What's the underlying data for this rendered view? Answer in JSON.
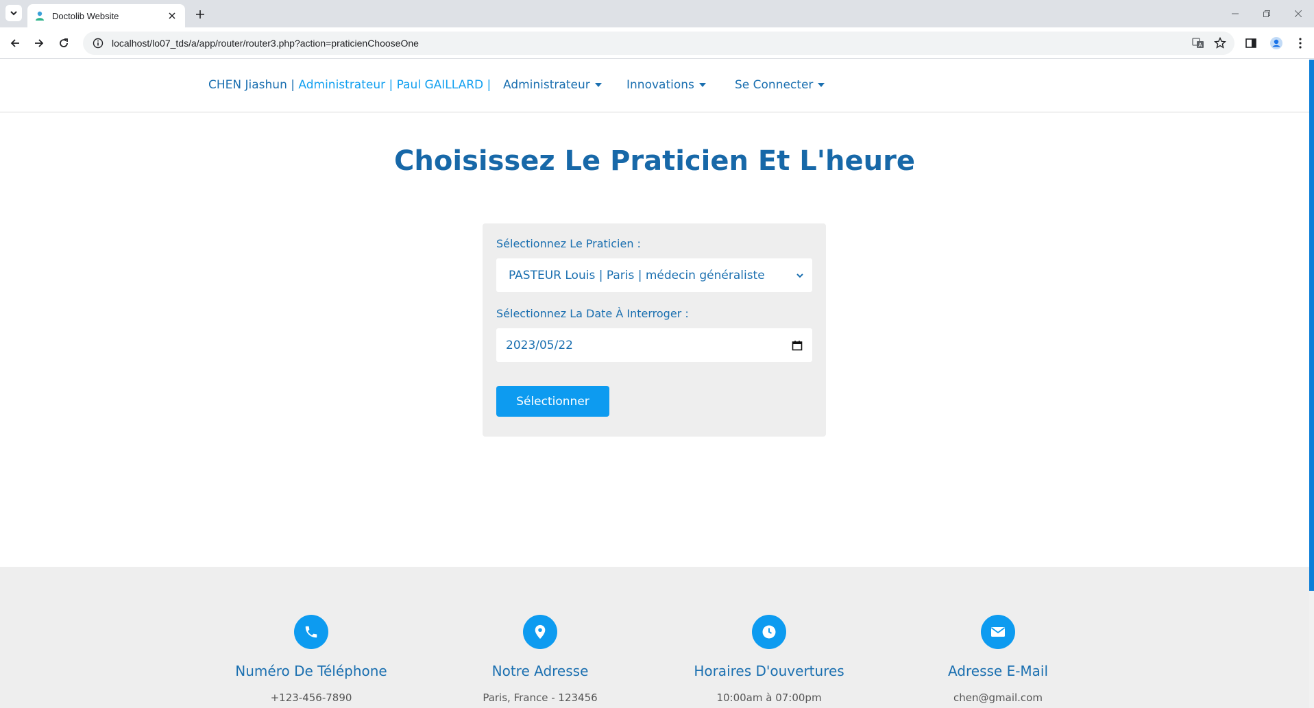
{
  "browser": {
    "tab_title": "Doctolib Website",
    "url": "localhost/lo07_tds/a/app/router/router3.php?action=praticienChooseOne"
  },
  "navbar": {
    "user_name": "CHEN Jiashun | ",
    "user_roles": "Administrateur | Paul GAILLARD |",
    "menu_admin": "Administrateur",
    "menu_innovations": "Innovations",
    "menu_connect": "Se Connecter"
  },
  "main": {
    "title": "Choisissez Le Praticien Et L'heure",
    "form": {
      "praticien_label": "Sélectionnez Le Praticien :",
      "praticien_value": "PASTEUR Louis | Paris | médecin généraliste",
      "date_label": "Sélectionnez La Date À Interroger :",
      "date_value": "2023/05/22",
      "submit_label": "Sélectionner"
    }
  },
  "footer": {
    "phone": {
      "title": "Numéro De Téléphone",
      "text": "+123-456-7890",
      "icon": "phone-icon"
    },
    "address": {
      "title": "Notre Adresse",
      "text": "Paris, France - 123456",
      "icon": "map-pin-icon"
    },
    "hours": {
      "title": "Horaires D'ouvertures",
      "text": "10:00am à 07:00pm",
      "icon": "clock-icon"
    },
    "email": {
      "title": "Adresse E-Mail",
      "text": "chen@gmail.com",
      "icon": "envelope-icon"
    }
  },
  "colors": {
    "primary": "#1a6fb0",
    "accent": "#0d9bf0",
    "card_bg": "#eeeeee"
  }
}
